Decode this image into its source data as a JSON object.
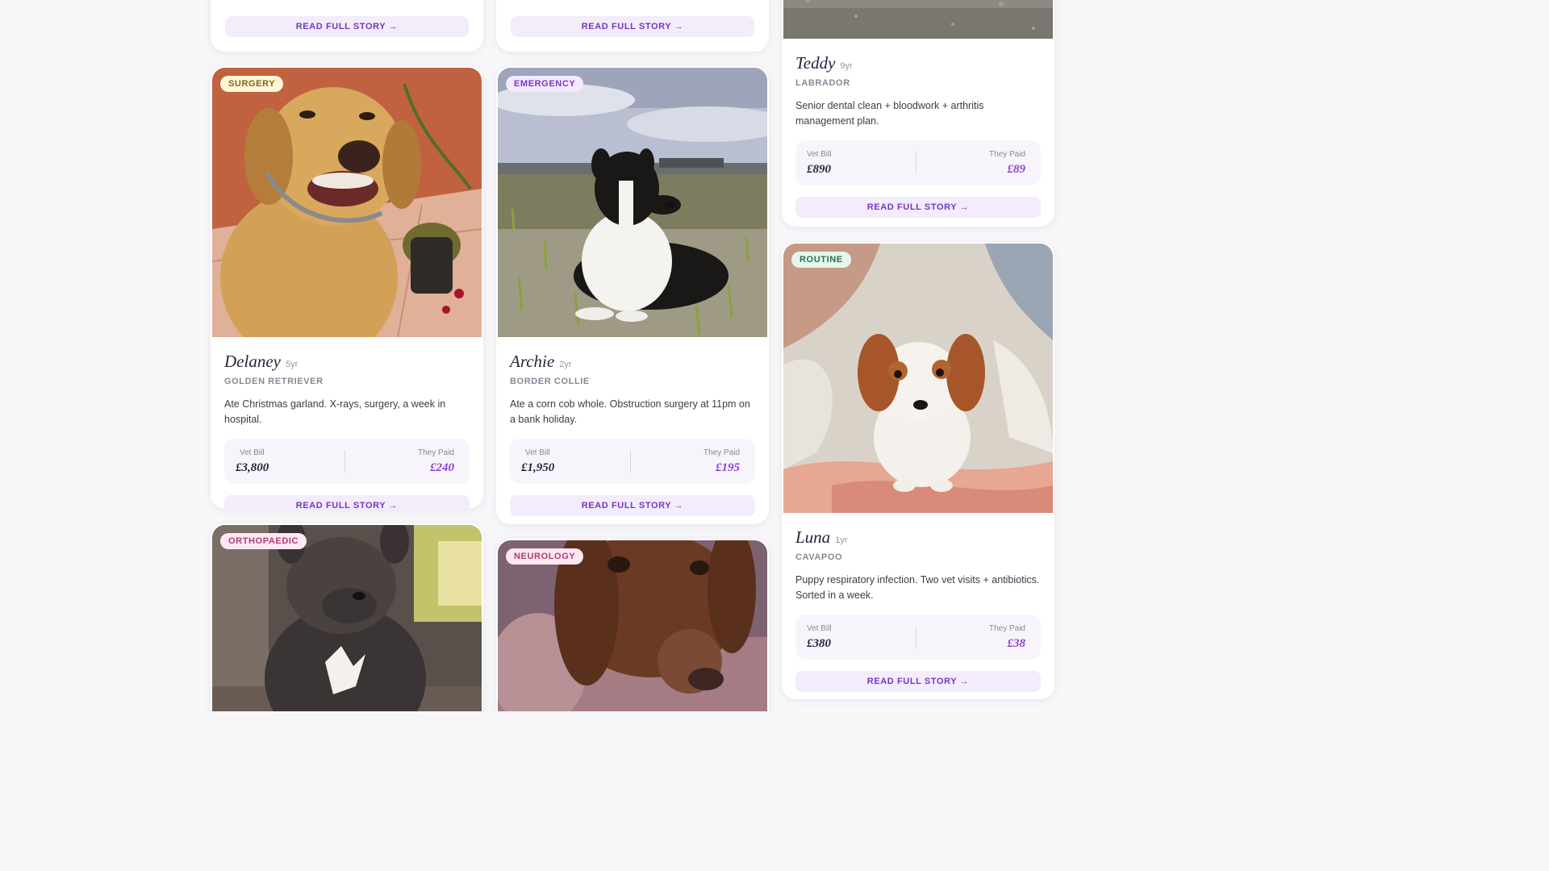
{
  "colors": {
    "accent": "#8d3fd6",
    "button_bg": "#f2ecfb",
    "page_bg": "#f7f6f9"
  },
  "labels": {
    "vet_bill": "Vet Bill",
    "they_paid": "They Paid",
    "read_story": "READ FULL STORY →"
  },
  "stories": {
    "delaney": {
      "tag": "SURGERY",
      "name": "Delaney",
      "age": "5yr",
      "breed": "GOLDEN RETRIEVER",
      "description": "Ate Christmas garland. X-rays, surgery, a week in hospital.",
      "vet_bill": "£3,800",
      "they_paid": "£240"
    },
    "archie": {
      "tag": "EMERGENCY",
      "name": "Archie",
      "age": "2yr",
      "breed": "BORDER COLLIE",
      "description": "Ate a corn cob whole. Obstruction surgery at 11pm on a bank holiday.",
      "vet_bill": "£1,950",
      "they_paid": "£195"
    },
    "teddy": {
      "name": "Teddy",
      "age": "9yr",
      "breed": "LABRADOR",
      "description": "Senior dental clean + bloodwork + arthritis management plan.",
      "vet_bill": "£890",
      "they_paid": "£89"
    },
    "luna": {
      "tag": "ROUTINE",
      "name": "Luna",
      "age": "1yr",
      "breed": "CAVAPOO",
      "description": "Puppy respiratory infection. Two vet visits + antibiotics. Sorted in a week.",
      "vet_bill": "£380",
      "they_paid": "£38"
    },
    "frenchie": {
      "tag": "ORTHOPAEDIC"
    },
    "dachshund": {
      "tag": "NEUROLOGY"
    }
  }
}
